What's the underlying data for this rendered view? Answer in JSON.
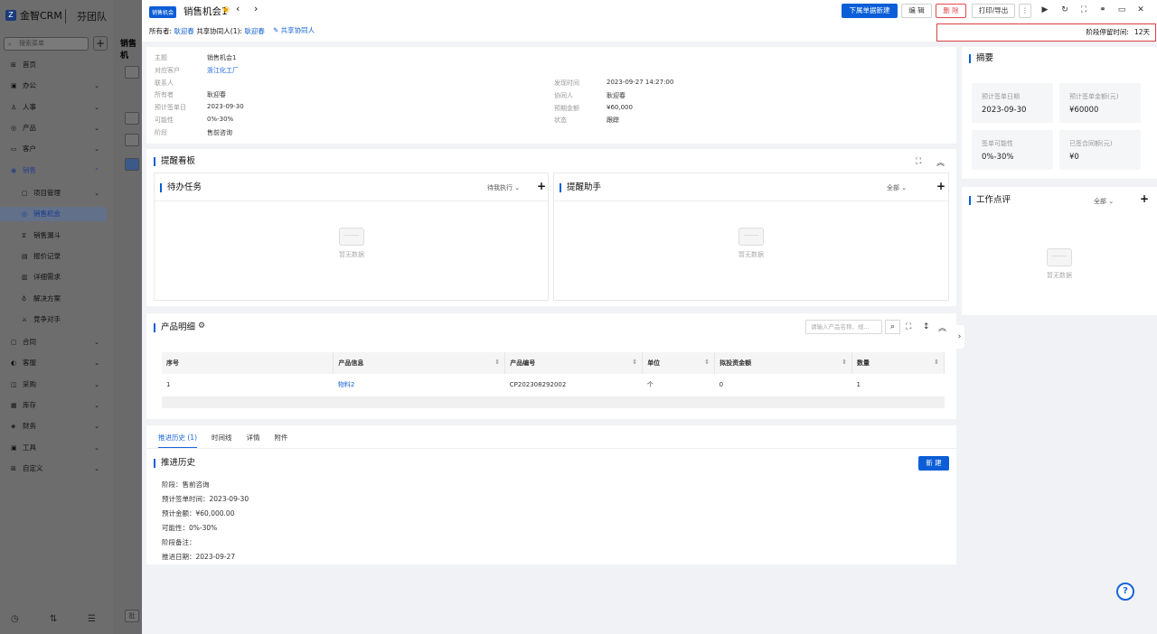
{
  "nav": {
    "logo": "金智CRM",
    "team": "芬团队",
    "search_placeholder": "搜索菜单",
    "add": "+",
    "items": [
      {
        "label": "首页",
        "icon": "home-icon",
        "glyph": "⊞"
      },
      {
        "label": "办公",
        "icon": "office-icon",
        "glyph": "▣",
        "chev": "⌄"
      },
      {
        "label": "人事",
        "icon": "people-icon",
        "glyph": "♙",
        "chev": "⌄"
      },
      {
        "label": "产品",
        "icon": "product-icon",
        "glyph": "◎",
        "chev": "⌄"
      },
      {
        "label": "客户",
        "icon": "customer-icon",
        "glyph": "▭",
        "chev": "⌄"
      },
      {
        "label": "销售",
        "icon": "sales-icon",
        "glyph": "◉",
        "chev": "⌃"
      }
    ],
    "sub_items": [
      {
        "label": "项目管理",
        "icon": "project-icon",
        "glyph": "▢",
        "chev": "⌄"
      },
      {
        "label": "销售机会",
        "icon": "opportunity-icon",
        "glyph": "◎"
      },
      {
        "label": "销售漏斗",
        "icon": "funnel-icon",
        "glyph": "⧖"
      },
      {
        "label": "报价记录",
        "icon": "quote-icon",
        "glyph": "▤"
      },
      {
        "label": "详细需求",
        "icon": "requirement-icon",
        "glyph": "▥"
      },
      {
        "label": "解决方案",
        "icon": "solution-icon",
        "glyph": "♁"
      },
      {
        "label": "竞争对手",
        "icon": "competitor-icon",
        "glyph": "⚔"
      }
    ],
    "more_items": [
      {
        "label": "合同",
        "icon": "contract-icon",
        "glyph": "▢",
        "chev": "⌄"
      },
      {
        "label": "客服",
        "icon": "service-icon",
        "glyph": "◐",
        "chev": "⌄"
      },
      {
        "label": "采购",
        "icon": "purchase-icon",
        "glyph": "◫",
        "chev": "⌄"
      },
      {
        "label": "库存",
        "icon": "stock-icon",
        "glyph": "▦",
        "chev": "⌄"
      },
      {
        "label": "财务",
        "icon": "finance-icon",
        "glyph": "◈",
        "chev": "⌄"
      },
      {
        "label": "工具",
        "icon": "tool-icon",
        "glyph": "▣",
        "chev": "⌄"
      },
      {
        "label": "自定义",
        "icon": "custom-icon",
        "glyph": "⊞",
        "chev": "⌄"
      }
    ],
    "bottom_icons": [
      {
        "name": "history-icon",
        "glyph": "◷"
      },
      {
        "name": "filter-icon",
        "glyph": "⇅"
      },
      {
        "name": "menu-icon",
        "glyph": "☰"
      }
    ]
  },
  "background": {
    "title": "销售机",
    "bottom_label": "批"
  },
  "header": {
    "tag": "销售机会",
    "title": "销售机会1",
    "star": "◉",
    "prev": "‹",
    "next": "›",
    "owner_label": "所有者:",
    "owner_value": "耿迎春",
    "shared_label": "共享协同人(1):",
    "shared_value": "耿迎春",
    "share_button": "✎ 共享协同人",
    "buttons": {
      "create_next": "下属单据新建",
      "edit": "编 辑",
      "delete": "删 除",
      "print": "打印/导出",
      "more": "⋮"
    },
    "icons": {
      "play": "▶",
      "refresh": "↻",
      "fullscreen": "⛶",
      "link": "⚭",
      "window": "▭",
      "close": "✕"
    },
    "stage_time_label": "阶段停留时间:",
    "stage_time_value": "12天"
  },
  "info": {
    "left": [
      {
        "label": "主题",
        "value": "销售机会1"
      },
      {
        "label": "对应客户",
        "value": "浙江化工厂",
        "link": true
      },
      {
        "label": "联系人",
        "value": ""
      },
      {
        "label": "所有者",
        "value": "耿迎春"
      },
      {
        "label": "预计签单日",
        "value": "2023-09-30"
      },
      {
        "label": "可能性",
        "value": "0%-30%"
      },
      {
        "label": "阶段",
        "value": "售前咨询"
      }
    ],
    "right": [
      {
        "label": "发现时间",
        "value": "2023-09-27 14:27:00"
      },
      {
        "label": "协同人",
        "value": "耿迎春"
      },
      {
        "label": "预期金额",
        "value": "¥60,000"
      },
      {
        "label": "状态",
        "value": "跟踪"
      }
    ]
  },
  "reminder": {
    "title": "提醒看板",
    "todo_title": "待办任务",
    "todo_filter": "待我执行 ⌄",
    "helper_title": "提醒助手",
    "helper_filter": "全部 ⌄",
    "empty": "暂无数据",
    "plus": "+",
    "expand": "⛶",
    "collapse": "︽"
  },
  "products": {
    "title": "产品明细",
    "gear": "⚙",
    "search_placeholder": "请输入产品名称、规...",
    "search_icon": "⌕",
    "expand": "⛶",
    "height": "↕",
    "collapse": "︽",
    "columns": [
      "序号",
      "产品信息",
      "产品编号",
      "单位",
      "拟投资金额",
      "数量"
    ],
    "sort_glyph": "⇕",
    "rows": [
      [
        "1",
        "物料2",
        "CP202308292002",
        "个",
        "0",
        "1"
      ]
    ]
  },
  "history": {
    "tabs": [
      "推进历史 (1)",
      "时间线",
      "详情",
      "附件"
    ],
    "title": "推进历史",
    "new_button": "新 建",
    "lines": [
      "阶段：售前咨询",
      "预计签单时间：2023-09-30",
      "预计金额：¥60,000.00",
      "可能性：0%-30%",
      "阶段备注：",
      "推进日期：2023-09-27"
    ]
  },
  "summary": {
    "title": "摘要",
    "items": [
      {
        "label": "预计签单日期",
        "value": "2023-09-30"
      },
      {
        "label": "预计签单金额(元)",
        "value": "¥60000"
      },
      {
        "label": "签单可能性",
        "value": "0%-30%"
      },
      {
        "label": "已签合同额(元)",
        "value": "¥0"
      }
    ]
  },
  "work_review": {
    "title": "工作点评",
    "filter": "全部 ⌄",
    "plus": "+",
    "empty": "暂无数据"
  },
  "misc": {
    "help": "?",
    "side_toggle": "›"
  },
  "colors": {
    "primary": "#0b5ed7",
    "danger": "#e24a4a",
    "highlight_border": "#d94040"
  }
}
